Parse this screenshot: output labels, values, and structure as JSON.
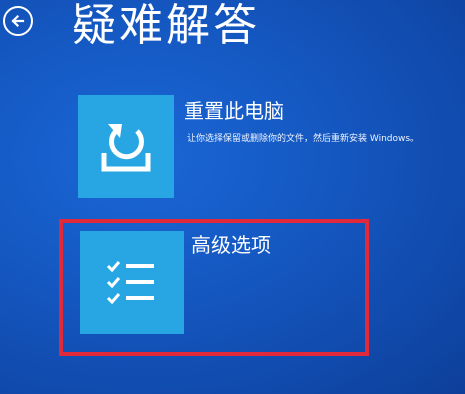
{
  "header": {
    "title": "疑难解答",
    "back_icon": "back-arrow-icon"
  },
  "options": [
    {
      "title": "重置此电脑",
      "description": "让你选择保留或删除你的文件，然后重新安装 Windows。",
      "icon": "reset-pc-icon"
    },
    {
      "title": "高级选项",
      "icon": "checklist-icon",
      "highlighted": true
    }
  ],
  "colors": {
    "background": "#1456bf",
    "tile": "#27a6e3",
    "highlight_border": "#e02a3c",
    "text": "#ffffff"
  }
}
